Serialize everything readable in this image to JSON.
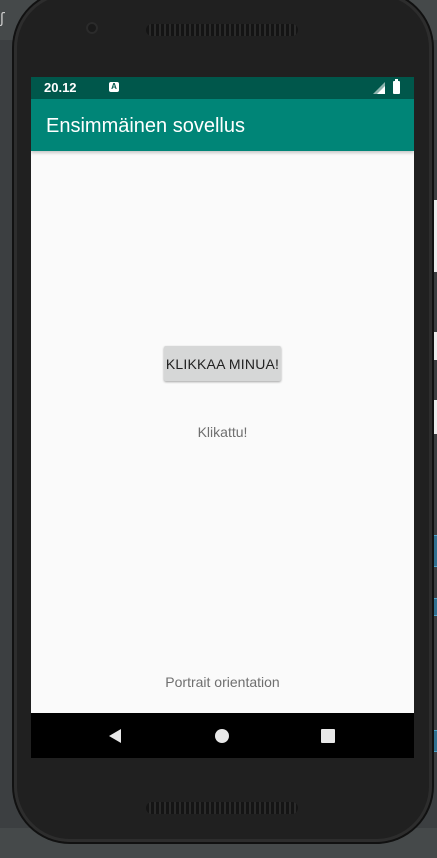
{
  "status_bar": {
    "time": "20.12",
    "notification_icon_letter": "A",
    "color": "#00574b"
  },
  "app_bar": {
    "title": "Ensimmäinen sovellus",
    "color": "#008577"
  },
  "main": {
    "button_label": "KLIKKAA MINUA!",
    "clicked_text": "Klikattu!",
    "orientation_text": "Portrait orientation"
  },
  "nav_bar": {
    "back_icon": "back-triangle-icon",
    "home_icon": "home-circle-icon",
    "recents_icon": "recents-square-icon"
  }
}
